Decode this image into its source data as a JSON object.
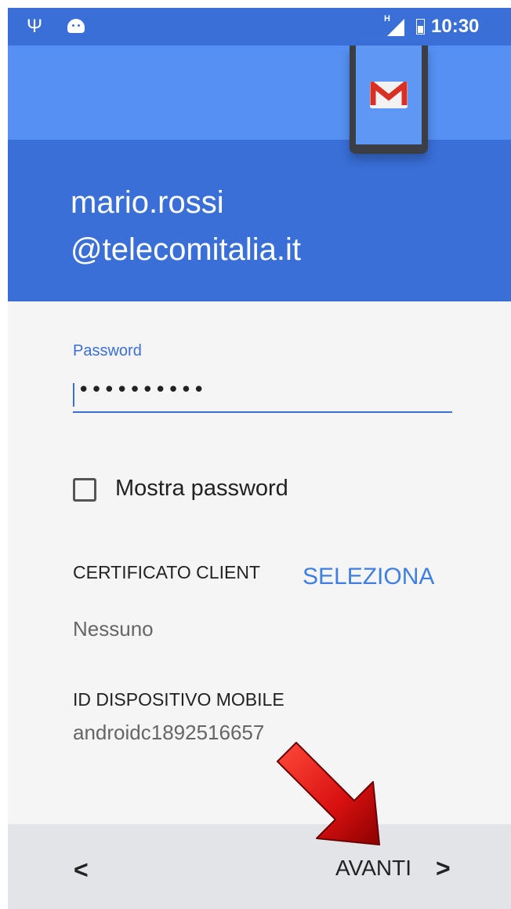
{
  "status_bar": {
    "network_type": "H",
    "time": "10:30",
    "icons": [
      "usb-icon",
      "android-icon",
      "signal-icon",
      "battery-icon"
    ]
  },
  "header": {
    "email_line1": "mario.rossi",
    "email_line2": "@telecomitalia.it",
    "app_icon": "gmail-icon",
    "colors": {
      "header_top": "#5590f2",
      "header_bottom": "#3a6fd8"
    }
  },
  "form": {
    "password_label": "Password",
    "password_value": "••••••••••",
    "show_password_label": "Mostra password",
    "show_password_checked": false,
    "client_cert_title": "CERTIFICATO CLIENT",
    "client_cert_value": "Nessuno",
    "select_button": "SELEZIONA",
    "device_id_title": "ID DISPOSITIVO MOBILE",
    "device_id_value": "androidc1892516657"
  },
  "footer": {
    "back_label": "<",
    "next_label": "AVANTI",
    "next_chevron": ">"
  },
  "annotation": {
    "arrow_color": "#d81010"
  }
}
